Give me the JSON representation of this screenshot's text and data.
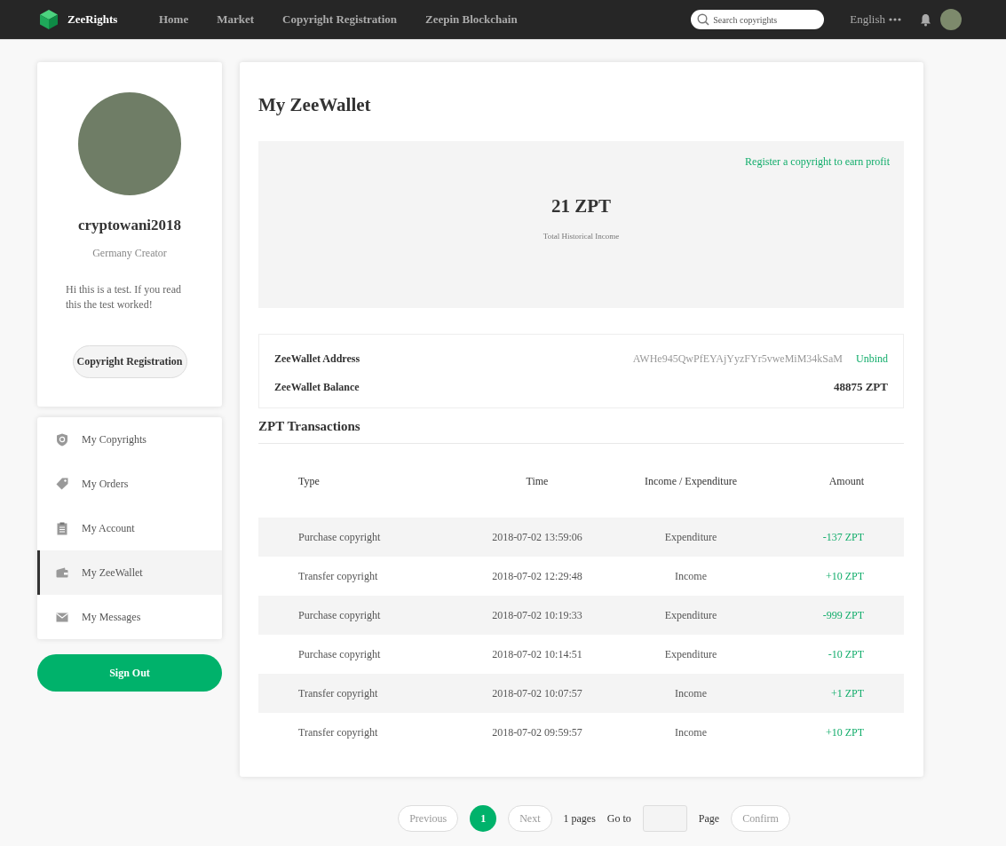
{
  "header": {
    "brand": "ZeeRights",
    "nav": [
      {
        "label": "Home"
      },
      {
        "label": "Market"
      },
      {
        "label": "Copyright Registration"
      },
      {
        "label": "Zeepin Blockchain"
      }
    ],
    "search": {
      "placeholder": "Search copyrights"
    },
    "language": "English"
  },
  "profile": {
    "username": "cryptowani2018",
    "subtitle": "Germany Creator",
    "bio": "Hi this is a test. If you read this the test worked!",
    "button": "Copyright Registration"
  },
  "sidebar": {
    "items": [
      {
        "label": "My Copyrights",
        "selected": false
      },
      {
        "label": "My Orders",
        "selected": false
      },
      {
        "label": "My Account",
        "selected": false
      },
      {
        "label": "My ZeeWallet",
        "selected": true
      },
      {
        "label": "My Messages",
        "selected": false
      }
    ],
    "sign_out": "Sign Out"
  },
  "wallet": {
    "title": "My ZeeWallet",
    "register_link": "Register a copyright to earn profit",
    "total": "21 ZPT",
    "total_label": "Total Historical Income",
    "address_label": "ZeeWallet Address",
    "address": "AWHe945QwPfEYAjYyzFYr5vweMiM34kSaM",
    "unbind": "Unbind",
    "balance_label": "ZeeWallet Balance",
    "balance": "48875 ZPT"
  },
  "transactions": {
    "title": "ZPT Transactions",
    "columns": [
      "Type",
      "Time",
      "Income / Expenditure",
      "Amount"
    ],
    "rows": [
      [
        "Purchase copyright",
        "2018-07-02 13:59:06",
        "Expenditure",
        "-137 ZPT"
      ],
      [
        "Transfer copyright",
        "2018-07-02 12:29:48",
        "Income",
        "+10 ZPT"
      ],
      [
        "Purchase copyright",
        "2018-07-02 10:19:33",
        "Expenditure",
        "-999 ZPT"
      ],
      [
        "Purchase copyright",
        "2018-07-02 10:14:51",
        "Expenditure",
        "-10 ZPT"
      ],
      [
        "Transfer copyright",
        "2018-07-02 10:07:57",
        "Income",
        "+1 ZPT"
      ],
      [
        "Transfer copyright",
        "2018-07-02 09:59:57",
        "Income",
        "+10 ZPT"
      ]
    ]
  },
  "pagination": {
    "previous": "Previous",
    "pages": [
      {
        "label": "1",
        "selected": true
      }
    ],
    "next": "Next",
    "total": "1 pages",
    "goto": "Go to",
    "page": "Page",
    "confirm": "Confirm"
  }
}
